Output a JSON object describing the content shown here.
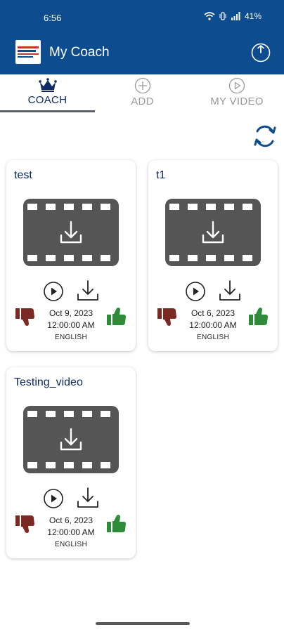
{
  "status_bar": {
    "time": "6:56",
    "battery": "41%"
  },
  "app_bar": {
    "title": "My Coach"
  },
  "tabs": [
    {
      "label": "COACH",
      "icon": "crown-icon",
      "active": true
    },
    {
      "label": "ADD",
      "icon": "plus-circle-icon",
      "active": false
    },
    {
      "label": "MY VIDEO",
      "icon": "play-circle-icon",
      "active": false
    }
  ],
  "videos": [
    {
      "title": "test",
      "date": "Oct 9, 2023",
      "time": "12:00:00 AM",
      "language": "ENGLISH"
    },
    {
      "title": "t1",
      "date": "Oct 6, 2023",
      "time": "12:00:00 AM",
      "language": "ENGLISH"
    },
    {
      "title": "Testing_video",
      "date": "Oct 6, 2023",
      "time": "12:00:00 AM",
      "language": "ENGLISH"
    }
  ],
  "colors": {
    "primary": "#0d4d8f",
    "title_text": "#0d2a66",
    "thumb_down": "#7a2a22",
    "thumb_up": "#2e8b3a",
    "video_thumb": "#555555"
  }
}
